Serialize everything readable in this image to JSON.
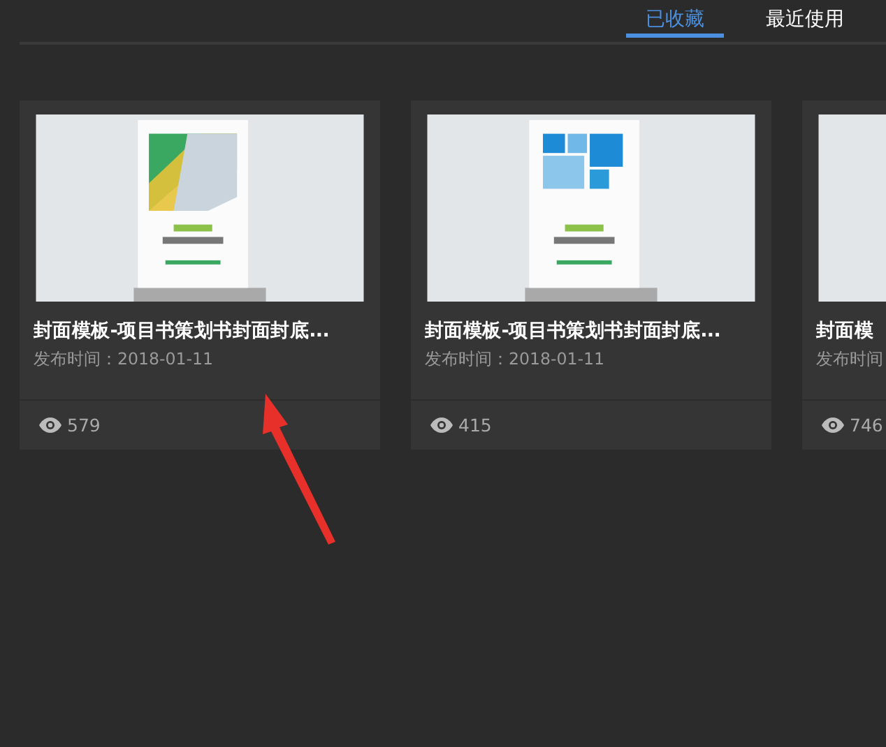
{
  "tabs": [
    {
      "label": "已收藏",
      "selected": true
    },
    {
      "label": "最近使用",
      "selected": false
    }
  ],
  "cards": [
    {
      "title": "封面模板-项目书策划书封面封底...",
      "date": "发布时间：2018-01-11",
      "views": "579"
    },
    {
      "title": "封面模板-项目书策划书封面封底...",
      "date": "发布时间：2018-01-11",
      "views": "415"
    },
    {
      "title": "封面模",
      "date": "发布时间",
      "views": "746"
    }
  ]
}
